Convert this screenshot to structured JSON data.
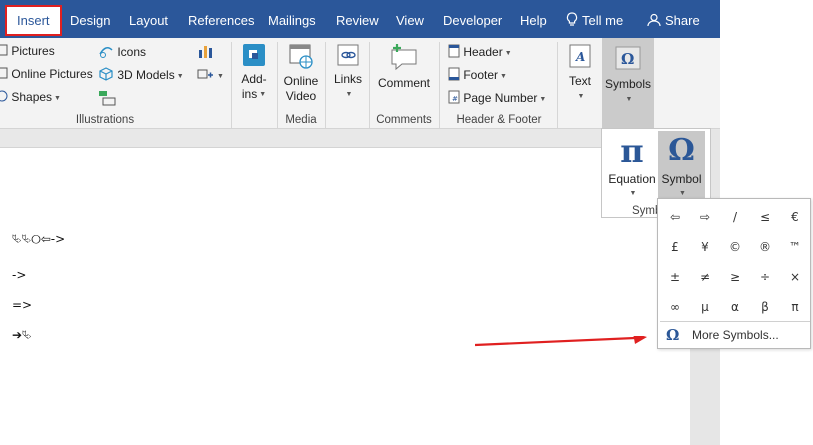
{
  "tabs": [
    {
      "label": "Insert",
      "active": true
    },
    {
      "label": "Design"
    },
    {
      "label": "Layout"
    },
    {
      "label": "References"
    },
    {
      "label": "Mailings"
    },
    {
      "label": "Review"
    },
    {
      "label": "View"
    },
    {
      "label": "Developer"
    },
    {
      "label": "Help"
    },
    {
      "label": "Tell me",
      "icon": "lightbulb-icon"
    },
    {
      "label": "Share",
      "icon": "person-icon"
    }
  ],
  "illustrations": {
    "pictures": "Pictures",
    "online_pictures": "Online Pictures",
    "shapes": "Shapes",
    "icons": "Icons",
    "models": "3D Models",
    "label": "Illustrations"
  },
  "addins": {
    "line1": "Add-",
    "line2": "ins"
  },
  "media": {
    "line1": "Online",
    "line2": "Video",
    "label": "Media"
  },
  "links": {
    "label": "Links"
  },
  "comments": {
    "button": "Comment",
    "label": "Comments"
  },
  "header_footer": {
    "header": "Header",
    "footer": "Footer",
    "page_number": "Page Number",
    "label": "Header & Footer"
  },
  "text": {
    "label": "Text"
  },
  "symbols": {
    "label": "Symbols"
  },
  "symbols_menu": {
    "equation": "Equation",
    "symbol": "Symbol",
    "group_label_partial": "Symb"
  },
  "symbol_grid": {
    "cells": [
      "⇦",
      "⇨",
      "/",
      "≤",
      "€",
      "£",
      "¥",
      "©",
      "®",
      "™",
      "±",
      "≠",
      "≥",
      "÷",
      "×",
      "∞",
      "µ",
      "α",
      "β",
      "π"
    ],
    "more": "More Symbols..."
  },
  "document": {
    "lines": [
      "⮱⮱⭘⇦->",
      "->",
      "=>",
      "➔⮱"
    ]
  },
  "colors": {
    "accent": "#2b579a",
    "highlight_border": "#e02020",
    "arrow": "#e02020"
  }
}
